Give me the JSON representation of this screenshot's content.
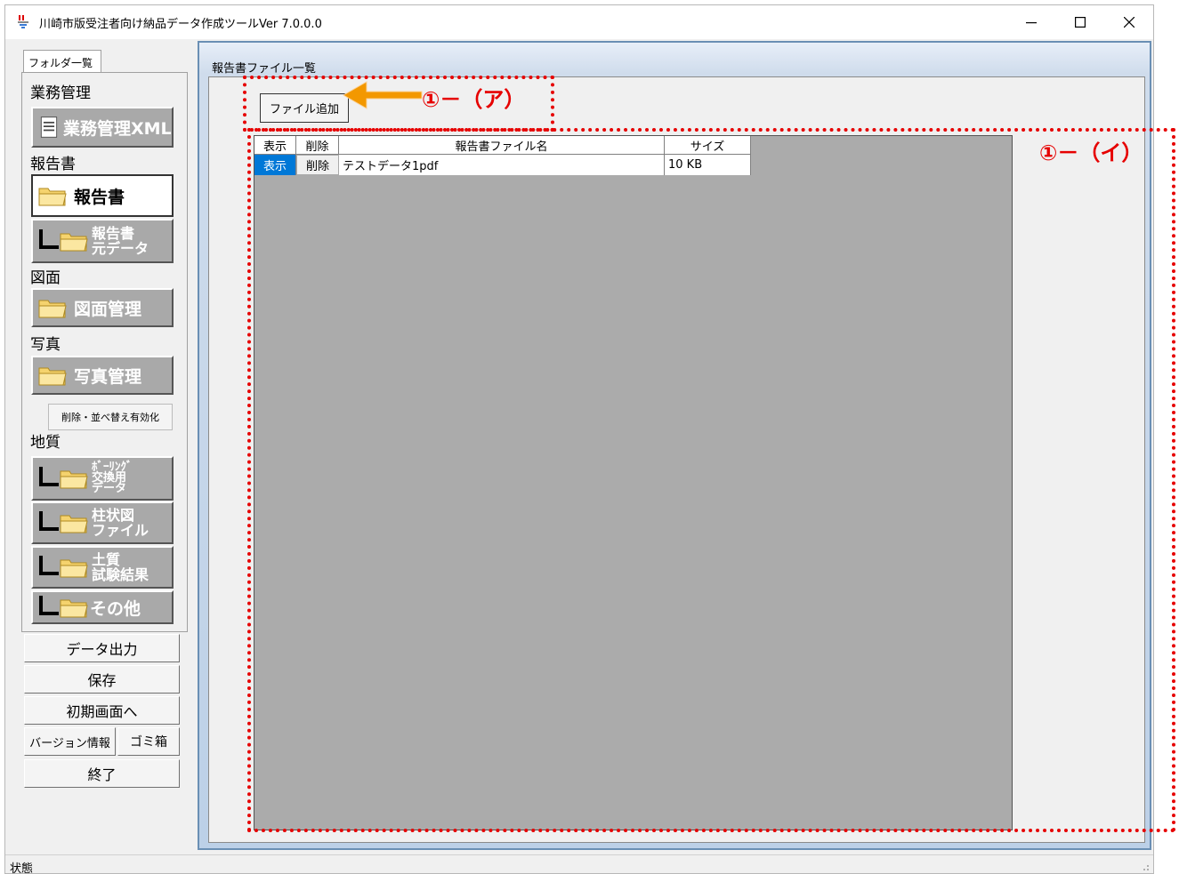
{
  "window": {
    "title": "川崎市版受注者向け納品データ作成ツールVer 7.0.0.0",
    "controls": {
      "minimize": "—",
      "maximize": "☐",
      "close": "✕"
    }
  },
  "left": {
    "tab_label": "フォルダ一覧",
    "sections": {
      "gyomu": "業務管理",
      "report": "報告書",
      "drawing": "図面",
      "photo": "写真",
      "geology": "地質"
    },
    "buttons": {
      "gyomu_xml": "業務管理XML",
      "report": "報告書",
      "report_src_line1": "報告書",
      "report_src_line2": "元データ",
      "drawing_mgmt": "図面管理",
      "photo_mgmt": "写真管理",
      "photo_toggle": "削除・並べ替え有効化",
      "boring_line1": "ﾎﾞｰﾘﾝｸﾞ",
      "boring_line2": "交換用",
      "boring_line3": "データ",
      "column_line1": "柱状図",
      "column_line2": "ファイル",
      "soil_line1": "土質",
      "soil_line2": "試験結果",
      "other": "その他"
    },
    "bottom": {
      "data_output": "データ出力",
      "save": "保存",
      "to_initial": "初期画面へ",
      "version": "バージョン情報",
      "trash": "ゴミ箱",
      "exit": "終了"
    }
  },
  "main": {
    "header": "報告書ファイル一覧",
    "add_file_button": "ファイル追加",
    "grid": {
      "columns": [
        "表示",
        "削除",
        "報告書ファイル名",
        "サイズ"
      ],
      "rows": [
        {
          "show": "表示",
          "delete": "削除",
          "filename": "テストデータ1pdf",
          "size": "10 KB"
        }
      ]
    }
  },
  "annotations": {
    "a": "①－（ア）",
    "b": "①－（イ）",
    "color": "#e60000",
    "arrow_color": "#f39800"
  },
  "status": {
    "label": "状態"
  }
}
